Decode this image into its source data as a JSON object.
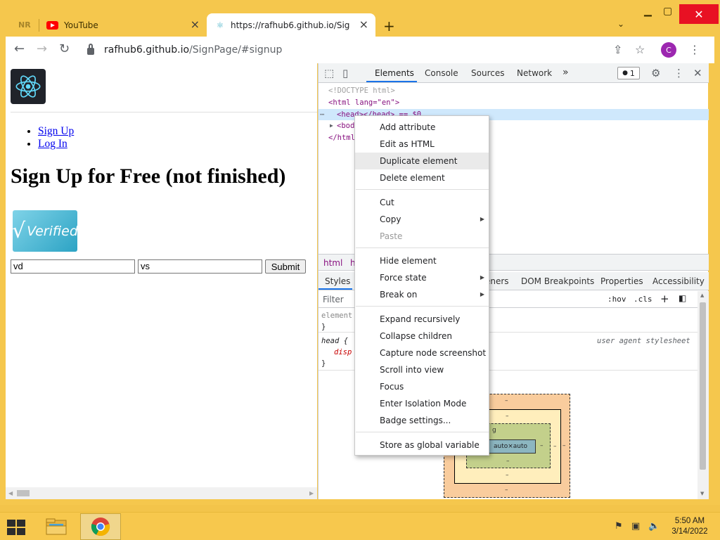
{
  "browser": {
    "tabs": [
      {
        "title": "NR"
      },
      {
        "title": "YouTube"
      },
      {
        "title": "https://rafhub6.github.io/SignPa"
      }
    ],
    "new_tab_label": "+",
    "url_host": "rafhub6.github.io",
    "url_path": "/SignPage/#signup",
    "profile_initial": "C"
  },
  "page": {
    "nav_links": [
      "Sign Up",
      "Log In"
    ],
    "heading": "Sign Up for Free (not finished)",
    "verified_text": "Verified",
    "input1_value": "vd",
    "input2_value": "vs",
    "submit_label": "Submit"
  },
  "devtools": {
    "tabs": [
      "Elements",
      "Console",
      "Sources",
      "Network"
    ],
    "more_tabs": "»",
    "issues_badge": "1",
    "dom_lines": [
      "<!DOCTYPE html>",
      "<html lang=\"en\">",
      "<head></head> == $0",
      "<bod",
      "</html"
    ],
    "breadcrumbs": [
      "html",
      "h"
    ],
    "sub_tabs": [
      "Styles",
      "eners",
      "DOM Breakpoints",
      "Properties",
      "Accessibility"
    ],
    "filter_placeholder": "Filter",
    "hov": ":hov",
    "cls": ".cls",
    "styles_lines": [
      "element",
      "}",
      "head {",
      "disp",
      "}"
    ],
    "user_agent_label": "user agent stylesheet",
    "box_content": "auto×auto",
    "box_dash": "–",
    "box_label": "g"
  },
  "context_menu": {
    "groups": [
      [
        {
          "label": "Add attribute"
        },
        {
          "label": "Edit as HTML"
        },
        {
          "label": "Duplicate element",
          "highlighted": true
        },
        {
          "label": "Delete element"
        }
      ],
      [
        {
          "label": "Cut"
        },
        {
          "label": "Copy",
          "submenu": true
        },
        {
          "label": "Paste",
          "disabled": true
        }
      ],
      [
        {
          "label": "Hide element"
        },
        {
          "label": "Force state",
          "submenu": true
        },
        {
          "label": "Break on",
          "submenu": true
        }
      ],
      [
        {
          "label": "Expand recursively"
        },
        {
          "label": "Collapse children"
        },
        {
          "label": "Capture node screenshot"
        },
        {
          "label": "Scroll into view"
        },
        {
          "label": "Focus"
        },
        {
          "label": "Enter Isolation Mode"
        },
        {
          "label": "Badge settings..."
        }
      ],
      [
        {
          "label": "Store as global variable"
        }
      ]
    ]
  },
  "taskbar": {
    "time": "5:50 AM",
    "date": "3/14/2022"
  },
  "colors": {
    "theme_yellow": "#f5c74d",
    "link_blue": "#0000ee",
    "selection_blue": "#cfe8fc",
    "accent_blue": "#1a73e8",
    "profile_purple": "#9c27b0"
  }
}
